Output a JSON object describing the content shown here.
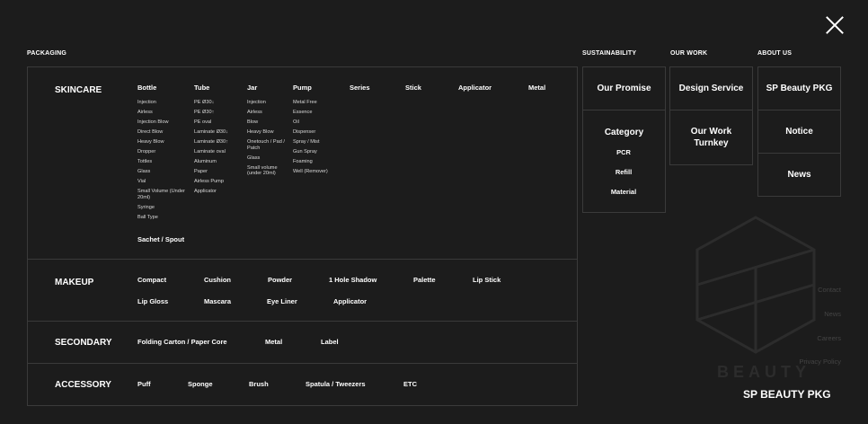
{
  "headers": {
    "packaging": "PACKAGING",
    "sustainability": "SUSTAINABILITY",
    "our_work": "OUR WORK",
    "about_us": "ABOUT US"
  },
  "skincare": {
    "title": "SKINCARE",
    "columns": [
      {
        "name": "Bottle",
        "items": [
          "Injection",
          "Airless",
          "Injection Blow",
          "Direct Blow",
          "Heavy Blow",
          "Dropper",
          "Tottles",
          "Glass",
          "Vial",
          "Small Volume (Under 20ml)",
          "Syringe",
          "Ball Type"
        ]
      },
      {
        "name": "Tube",
        "items": [
          "PE Ø30↓",
          "PE Ø30↑",
          "PE oval",
          "Laminate Ø30↓",
          "Laminate Ø30↑",
          "Laminate oval",
          "Aluminum",
          "Paper",
          "Airless Pump",
          "Applicator"
        ]
      },
      {
        "name": "Jar",
        "items": [
          "Injection",
          "Airless",
          "Blow",
          "Heavy Blow",
          "Onetouch / Pad / Patch",
          "Glass",
          "Small volume (under 20ml)"
        ]
      },
      {
        "name": "Pump",
        "items": [
          "Metal Free",
          "Essence",
          "Oil",
          "Dispenser",
          "Spray / Mist",
          "Gun Spray",
          "Foaming",
          "Well (Remover)"
        ]
      },
      {
        "name": "Series",
        "items": []
      },
      {
        "name": "Stick",
        "items": []
      },
      {
        "name": "Applicator",
        "items": []
      },
      {
        "name": "Metal",
        "items": []
      }
    ],
    "extra": "Sachet / Spout"
  },
  "makeup": {
    "title": "MAKEUP",
    "row1": [
      "Compact",
      "Cushion",
      "Powder",
      "1 Hole Shadow",
      "Palette",
      "Lip Stick"
    ],
    "row2": [
      "Lip Gloss",
      "Mascara",
      "Eye Liner",
      "Applicator"
    ]
  },
  "secondary": {
    "title": "SECONDARY",
    "items": [
      "Folding Carton / Paper Core",
      "Metal",
      "Label"
    ]
  },
  "accessory": {
    "title": "ACCESSORY",
    "items": [
      "Puff",
      "Sponge",
      "Brush",
      "Spatula / Tweezers",
      "ETC"
    ]
  },
  "sustainability": {
    "promise": "Our Promise",
    "category": "Category",
    "subs": [
      "PCR",
      "Refill",
      "Material"
    ]
  },
  "our_work": {
    "design": "Design Service",
    "turnkey": "Our Work Turnkey"
  },
  "about_us": {
    "items": [
      "SP Beauty PKG",
      "Notice",
      "News"
    ]
  },
  "footer": {
    "links": [
      "Contact",
      "News",
      "Careers",
      "Privacy Policy"
    ],
    "brand": "SP BEAUTY PKG",
    "watermark": "BEAUTY"
  }
}
